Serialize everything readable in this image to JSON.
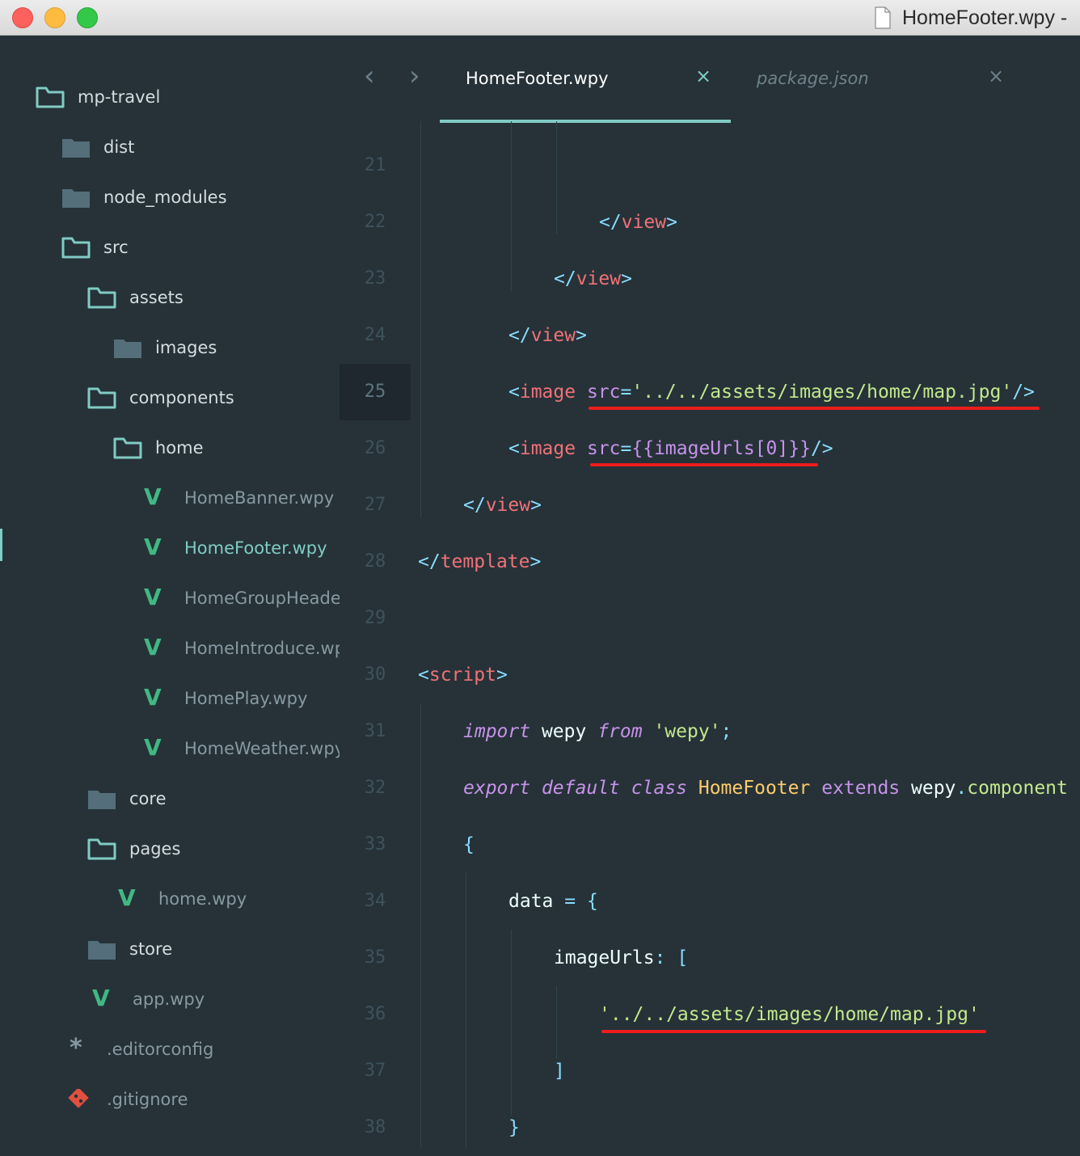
{
  "window": {
    "title": "HomeFooter.wpy -"
  },
  "sidebar": {
    "items": [
      {
        "label": "mp-travel",
        "kind": "folder-open"
      },
      {
        "label": "dist",
        "kind": "folder"
      },
      {
        "label": "node_modules",
        "kind": "folder"
      },
      {
        "label": "src",
        "kind": "folder-open"
      },
      {
        "label": "assets",
        "kind": "folder-open"
      },
      {
        "label": "images",
        "kind": "folder"
      },
      {
        "label": "components",
        "kind": "folder-open"
      },
      {
        "label": "home",
        "kind": "folder-open"
      },
      {
        "label": "HomeBanner.wpy",
        "kind": "vue-file"
      },
      {
        "label": "HomeFooter.wpy",
        "kind": "vue-file",
        "active": true
      },
      {
        "label": "HomeGroupHeader.",
        "kind": "vue-file"
      },
      {
        "label": "HomeIntroduce.wpy",
        "kind": "vue-file"
      },
      {
        "label": "HomePlay.wpy",
        "kind": "vue-file"
      },
      {
        "label": "HomeWeather.wpy",
        "kind": "vue-file"
      },
      {
        "label": "core",
        "kind": "folder"
      },
      {
        "label": "pages",
        "kind": "folder-open"
      },
      {
        "label": "home.wpy",
        "kind": "vue-file"
      },
      {
        "label": "store",
        "kind": "folder"
      },
      {
        "label": "app.wpy",
        "kind": "vue-file"
      },
      {
        "label": ".editorconfig",
        "kind": "config-file"
      },
      {
        "label": ".gitignore",
        "kind": "git-file"
      }
    ]
  },
  "tabs": [
    {
      "label": "HomeFooter.wpy",
      "close": "×",
      "active": true
    },
    {
      "label": "package.json",
      "close": "×",
      "active": false
    }
  ],
  "nav": {
    "back": "‹",
    "forward": "›"
  },
  "gutter": {
    "lines": [
      "21",
      "22",
      "23",
      "24",
      "25",
      "26",
      "27",
      "28",
      "29",
      "30",
      "31",
      "32",
      "33",
      "34",
      "35",
      "36",
      "37",
      "38"
    ],
    "current": "25"
  },
  "code": {
    "l22": {
      "open": "</",
      "tag": "view",
      "close": ">"
    },
    "l23": {
      "open": "</",
      "tag": "view",
      "close": ">"
    },
    "l24": {
      "open": "</",
      "tag": "view",
      "close": ">"
    },
    "l25": {
      "open": "<",
      "tag": "image",
      "attr": "src",
      "eq": "=",
      "value": "'../../assets/images/home/map.jpg'",
      "close": "/>"
    },
    "l26": {
      "open": "<",
      "tag": "image",
      "attr": "src",
      "eq": "=",
      "value": "{{imageUrls[0]}}",
      "close": "/>"
    },
    "l27": {
      "open": "</",
      "tag": "view",
      "close": ">"
    },
    "l28": {
      "open": "</",
      "tag": "template",
      "close": ">"
    },
    "l30": {
      "open": "<",
      "tag": "script",
      "close": ">"
    },
    "l31": {
      "kw1": "import",
      "ident": "wepy",
      "kw2": "from",
      "str": "'wepy'",
      "semi": ";"
    },
    "l32": {
      "kw1": "export",
      "kw2": "default",
      "kw3": "class",
      "cls": "HomeFooter",
      "ext": "extends",
      "obj": "wepy",
      "dot": ".",
      "prop": "component"
    },
    "l33": {
      "brace": "{"
    },
    "l34": {
      "ident": "data",
      "op": "=",
      "brace": "{"
    },
    "l35": {
      "ident": "imageUrls",
      "colon": ":",
      "bracket": "["
    },
    "l36": {
      "str": "'../../assets/images/home/map.jpg'"
    },
    "l37": {
      "bracket": "]"
    },
    "l38": {
      "brace": "}"
    }
  },
  "colors": {
    "accent": "#80cbc4",
    "annotation": "#ee1c1c",
    "vue_green": "#41b883"
  }
}
